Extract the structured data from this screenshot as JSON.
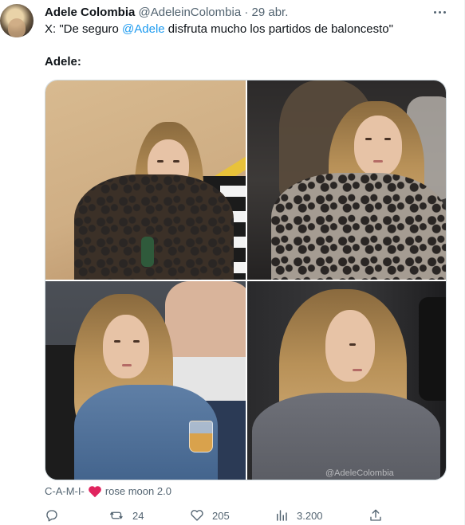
{
  "author": {
    "name": "Adele Colombia",
    "handle": "@AdeleinColombia",
    "separator": "·",
    "date": "29 abr."
  },
  "tweet": {
    "prefix": "X: \"De seguro ",
    "mention": "@Adele",
    "suffix": " disfruta mucho los partidos de baloncesto\"",
    "line2": "Adele:"
  },
  "media": {
    "watermark": "@AdeleColombia",
    "photos": [
      "photo-court",
      "photo-crowd-leopard",
      "photo-denim-drink",
      "photo-hoodie-profile"
    ]
  },
  "reply_line": {
    "user": "C-A-M-I-",
    "after": "rose moon 2.0",
    "heart_color": "#e0245e"
  },
  "actions": {
    "replies": "",
    "retweets": "24",
    "likes": "205",
    "views": "3.200",
    "icons": [
      "reply-icon",
      "retweet-icon",
      "like-icon",
      "views-icon",
      "share-icon"
    ]
  },
  "colors": {
    "accent": "#1d9bf0",
    "muted": "#536471",
    "text": "#0f1419"
  }
}
